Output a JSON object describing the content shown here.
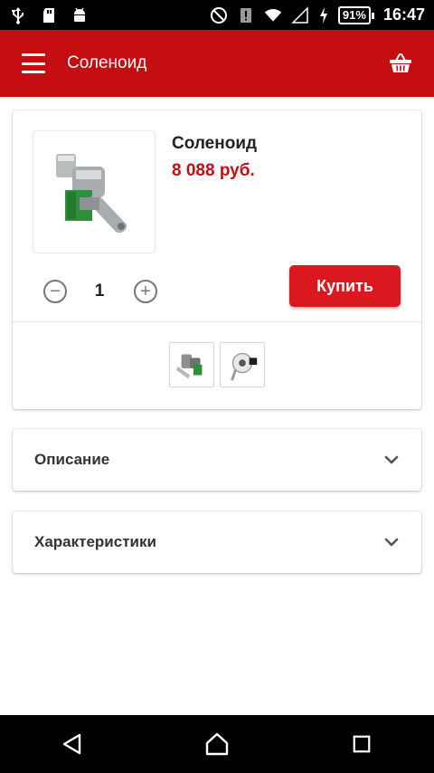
{
  "status_bar": {
    "battery": "91%",
    "time": "16:47",
    "icons": [
      "usb-icon",
      "sd-card-icon",
      "android-icon",
      "do-not-disturb-icon",
      "alert-icon",
      "wifi-icon",
      "signal-icon",
      "charging-icon"
    ]
  },
  "app_bar": {
    "title": "Соленоид",
    "menu_icon": "hamburger-menu-icon",
    "cart_icon": "basket-icon",
    "color": "#c50d12"
  },
  "product": {
    "name": "Соленоид",
    "price": "8 088 руб.",
    "quantity": "1",
    "buy_label": "Купить",
    "price_color": "#c50d12",
    "thumbnails": [
      "thumbnail-1",
      "thumbnail-2"
    ]
  },
  "sections": {
    "description_label": "Описание",
    "specs_label": "Характеристики"
  },
  "nav_bar": {
    "icons": [
      "back-icon",
      "home-icon",
      "recents-icon"
    ]
  }
}
